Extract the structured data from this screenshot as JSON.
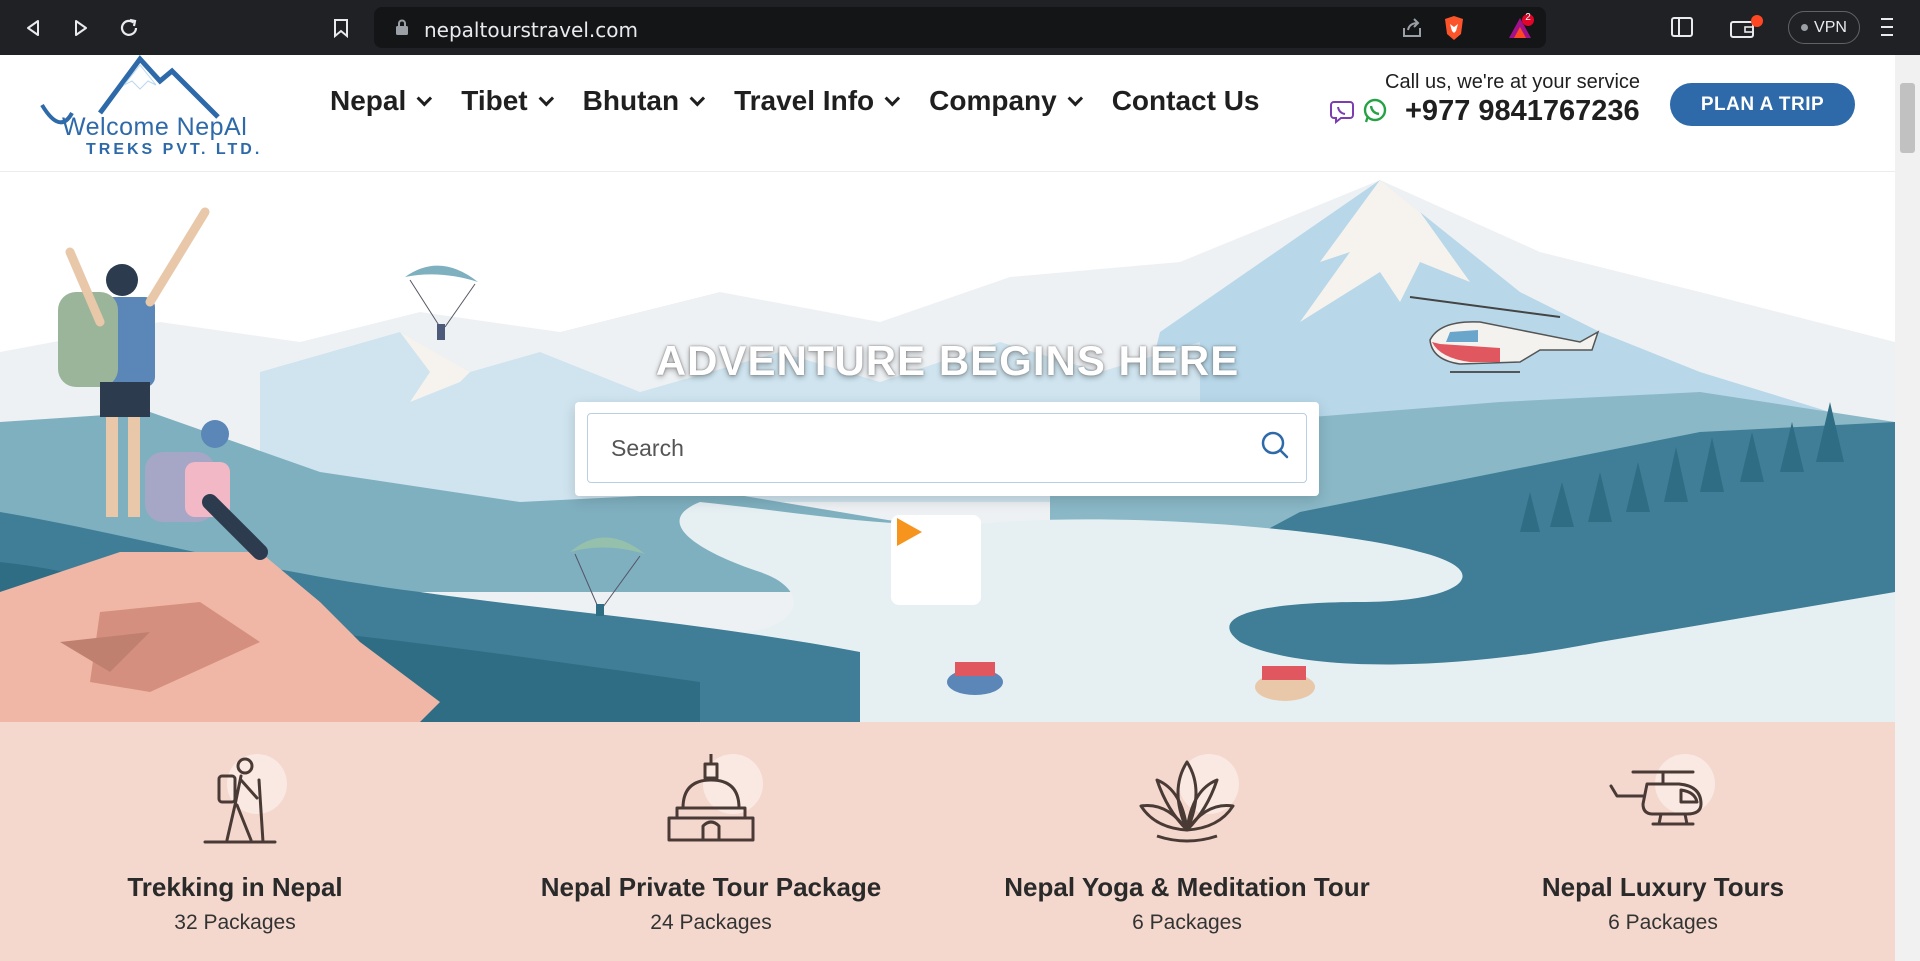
{
  "browser": {
    "url": "nepaltourstravel.com",
    "vpn_label": "VPN",
    "brave_badge": "2"
  },
  "logo": {
    "name": "Welcome NepAl",
    "sub": "TREKS PVT. LTD."
  },
  "nav": {
    "items": [
      {
        "label": "Nepal",
        "dropdown": true
      },
      {
        "label": "Tibet",
        "dropdown": true
      },
      {
        "label": "Bhutan",
        "dropdown": true
      },
      {
        "label": "Travel Info",
        "dropdown": true
      },
      {
        "label": "Company",
        "dropdown": true
      },
      {
        "label": "Contact Us",
        "dropdown": false
      }
    ]
  },
  "contact": {
    "call_label": "Call us, we're at your service",
    "phone": "+977 9841767236"
  },
  "cta": {
    "plan_trip": "PLAN A TRIP"
  },
  "hero": {
    "title": "ADVENTURE BEGINS HERE",
    "search_placeholder": "Search"
  },
  "categories": [
    {
      "title": "Trekking in Nepal",
      "count": "32 Packages",
      "icon": "hiker-icon"
    },
    {
      "title": "Nepal Private Tour Package",
      "count": "24 Packages",
      "icon": "stupa-icon"
    },
    {
      "title": "Nepal Yoga & Meditation Tour",
      "count": "6 Packages",
      "icon": "lotus-icon"
    },
    {
      "title": "Nepal Luxury Tours",
      "count": "6 Packages",
      "icon": "helicopter-icon"
    }
  ],
  "colors": {
    "brand_blue": "#2e6aa9",
    "play_orange": "#f7941d",
    "category_bg": "#f4d8ce"
  }
}
